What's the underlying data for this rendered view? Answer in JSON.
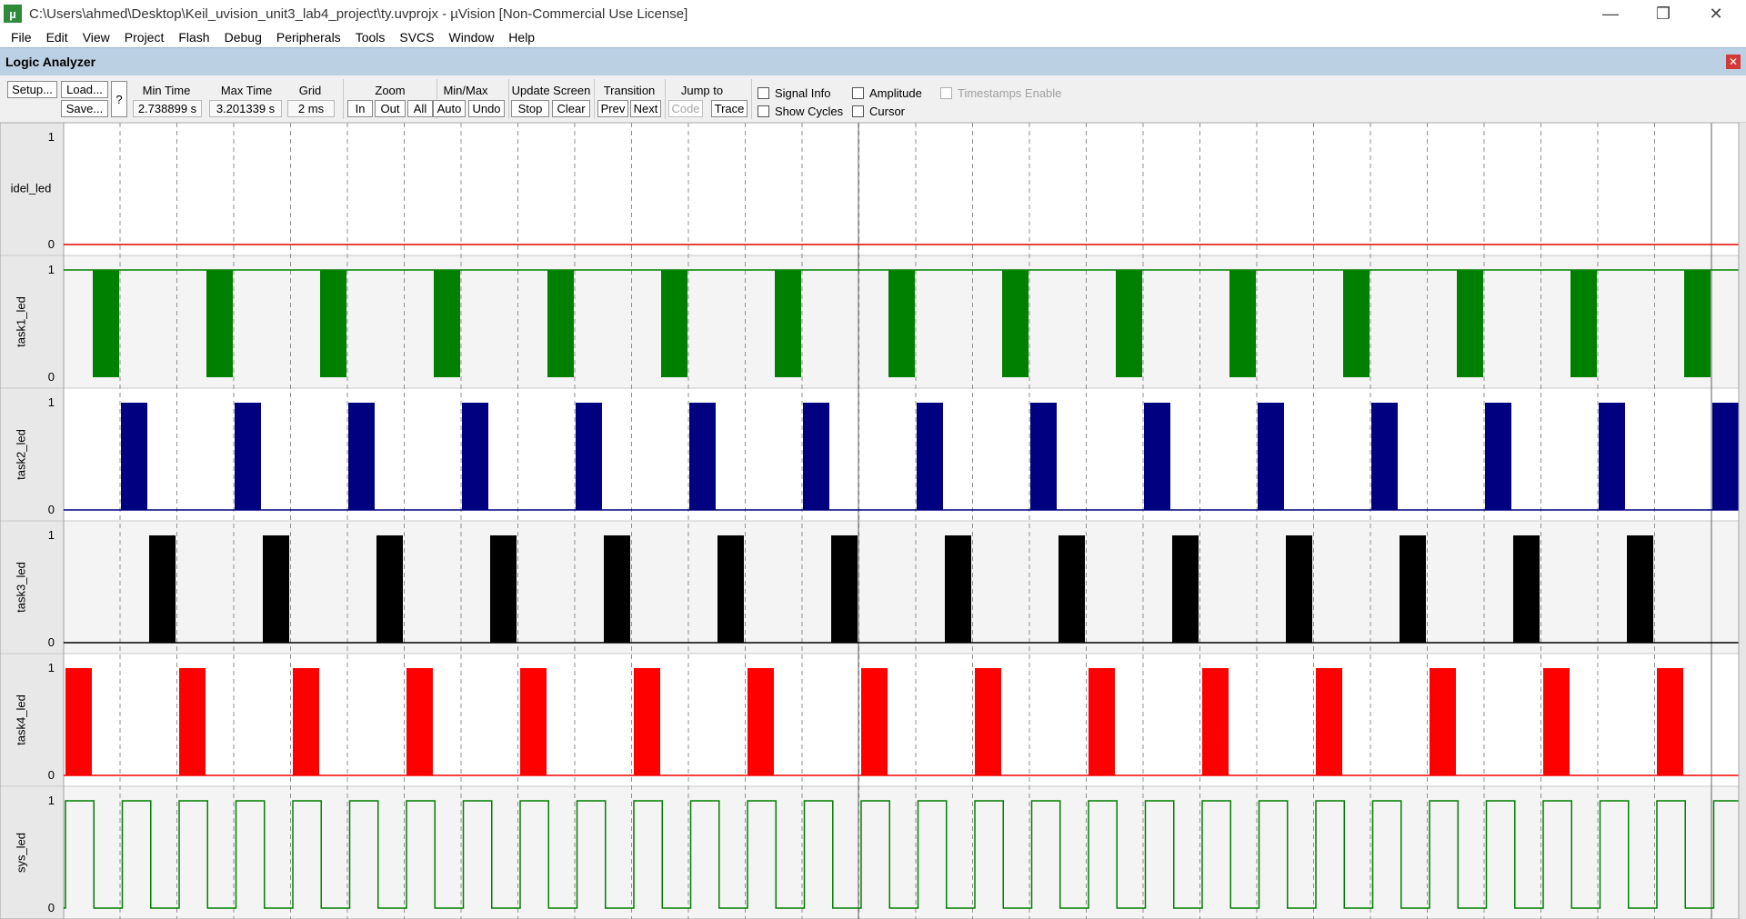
{
  "window": {
    "title": "C:\\Users\\ahmed\\Desktop\\Keil_uvision_unit3_lab4_project\\ty.uvprojx - µVision  [Non-Commercial Use License]",
    "app_icon": "µ"
  },
  "menu": [
    "File",
    "Edit",
    "View",
    "Project",
    "Flash",
    "Debug",
    "Peripherals",
    "Tools",
    "SVCS",
    "Window",
    "Help"
  ],
  "panel": {
    "title": "Logic Analyzer"
  },
  "toolbar": {
    "setup": "Setup...",
    "load": "Load...",
    "save": "Save...",
    "help": "?",
    "min_time_label": "Min Time",
    "min_time": "2.738899 s",
    "max_time_label": "Max Time",
    "max_time": "3.201339 s",
    "grid_label": "Grid",
    "grid": "2 ms",
    "zoom_label": "Zoom",
    "zoom_in": "In",
    "zoom_out": "Out",
    "zoom_all": "All",
    "minmax_label": "Min/Max",
    "auto": "Auto",
    "undo": "Undo",
    "update_label": "Update Screen",
    "stop": "Stop",
    "clear": "Clear",
    "transition_label": "Transition",
    "prev": "Prev",
    "next": "Next",
    "jumpto_label": "Jump to",
    "code": "Code",
    "trace": "Trace",
    "signal_info": "Signal Info",
    "show_cycles": "Show Cycles",
    "amplitude": "Amplitude",
    "cursor": "Cursor",
    "timestamps": "Timestamps Enable"
  },
  "signals": [
    {
      "name": "idel_led",
      "color": "#e00000",
      "max": "1",
      "min": "0",
      "pattern": "low",
      "bg": "#ffffff"
    },
    {
      "name": "task1_led",
      "color": "#008000",
      "max": "1",
      "min": "0",
      "pattern": "pulse_low",
      "phase": 0,
      "bg": "#f4f4f4"
    },
    {
      "name": "task2_led",
      "color": "#000080",
      "max": "1",
      "min": "0",
      "pattern": "pulse_high",
      "phase": 1,
      "bg": "#ffffff"
    },
    {
      "name": "task3_led",
      "color": "#000000",
      "max": "1",
      "min": "0",
      "pattern": "pulse_high",
      "phase": 2,
      "bg": "#f4f4f4"
    },
    {
      "name": "task4_led",
      "color": "#ff0000",
      "max": "1",
      "min": "0",
      "pattern": "pulse_high",
      "phase": 0,
      "bg": "#ffffff"
    },
    {
      "name": "sys_led",
      "color": "#008000",
      "max": "1",
      "min": "0",
      "pattern": "square",
      "bg": "#f4f4f4"
    }
  ]
}
